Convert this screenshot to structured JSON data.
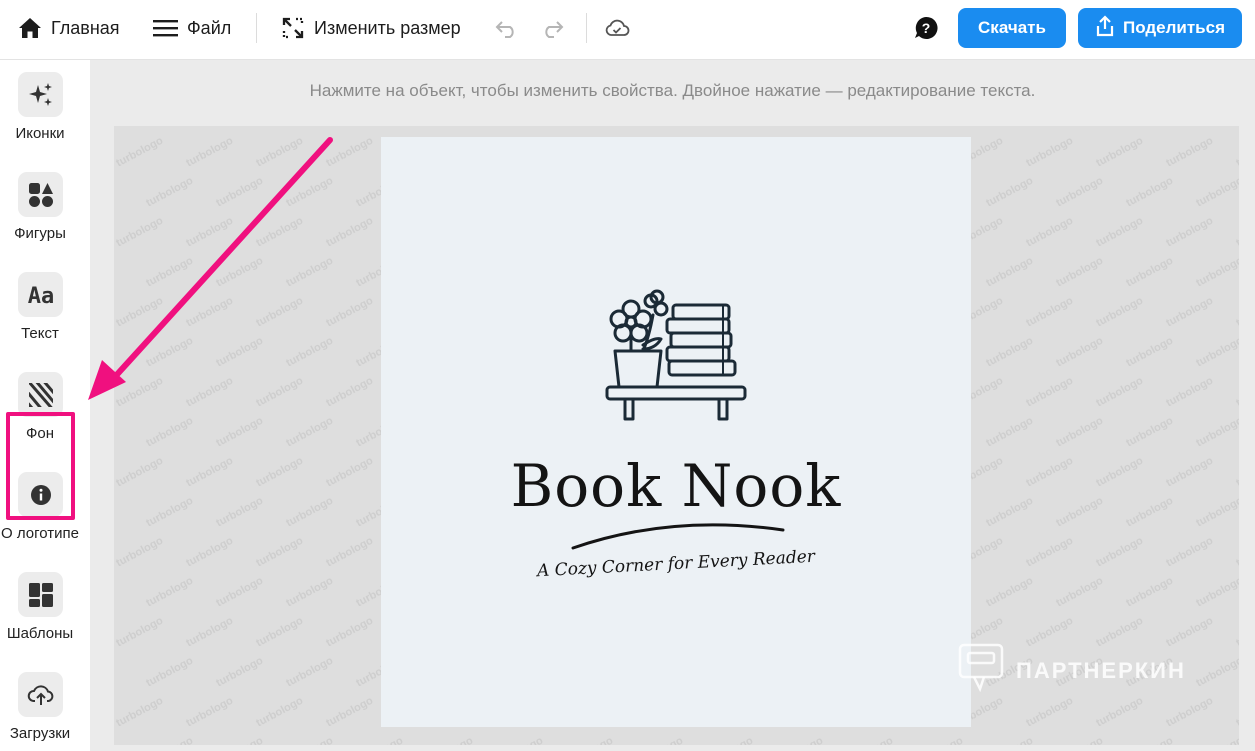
{
  "toolbar": {
    "home_label": "Главная",
    "file_label": "Файл",
    "resize_label": "Изменить размер",
    "download_label": "Скачать",
    "share_label": "Поделиться",
    "icons": [
      "home-icon",
      "menu-icon",
      "resize-icon",
      "undo-icon",
      "redo-icon",
      "cloud-save-icon",
      "help-icon",
      "share-icon"
    ]
  },
  "sidebar": {
    "items": [
      {
        "label": "Иконки",
        "icon": "sparkles-icon"
      },
      {
        "label": "Фигуры",
        "icon": "shapes-icon"
      },
      {
        "label": "Текст",
        "icon": "text-aa-icon"
      },
      {
        "label": "Фон",
        "icon": "background-stripes-icon"
      },
      {
        "label": "О логотипе",
        "icon": "info-icon"
      },
      {
        "label": "Шаблоны",
        "icon": "templates-grid-icon"
      },
      {
        "label": "Загрузки",
        "icon": "cloud-upload-icon"
      }
    ],
    "highlighted": "Фон"
  },
  "workspace": {
    "hint": "Нажмите на объект, чтобы изменить свойства. Двойное нажатие — редактирование текста.",
    "watermark_text": "turbologo",
    "logo": {
      "title": "Book Nook",
      "tagline": "A Cozy Corner for Every Reader",
      "icon": "plant-books-shelf-icon",
      "background_color": "#ecf1f5"
    }
  },
  "overlay": {
    "partner_text": "ПАРТНЕРКИН",
    "annotation_color": "#f0107f"
  },
  "colors": {
    "accent": "#1a8cf0",
    "highlight": "#f0107f"
  }
}
